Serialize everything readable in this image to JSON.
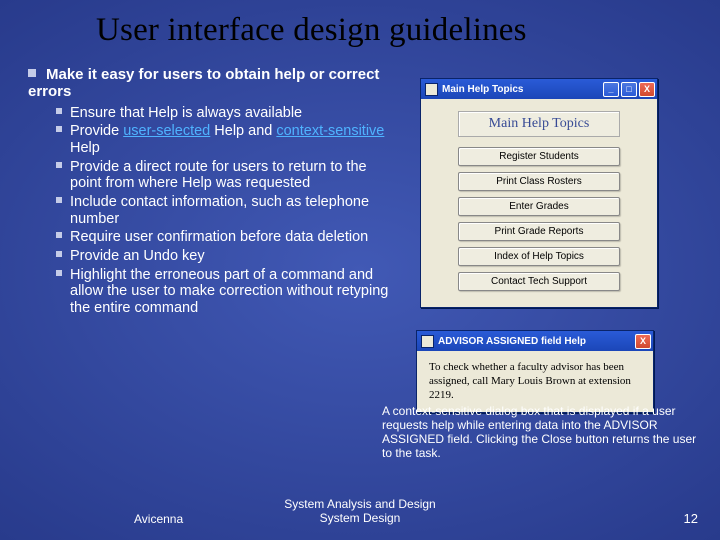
{
  "title": "User interface design guidelines",
  "bullet_heading": "Make it easy for users to obtain help or correct errors",
  "bullets": [
    "Ensure that Help is always available",
    {
      "pre": "Provide ",
      "link1": "user-selected",
      "mid": " Help and ",
      "link2": "context-sensitive",
      "post": " Help"
    },
    "Provide a direct route for users to return to the point from where Help was requested",
    "Include contact information, such as telephone number",
    "Require user confirmation before data deletion",
    "Provide an Undo key",
    "Highlight the erroneous part of a command and allow the user to make correction without retyping the entire command"
  ],
  "dialog1": {
    "title": "Main Help Topics",
    "banner": "Main Help Topics",
    "buttons": [
      "Register Students",
      "Print Class Rosters",
      "Enter Grades",
      "Print Grade Reports",
      "Index of Help Topics",
      "Contact Tech Support"
    ],
    "min": "_",
    "max": "□",
    "close": "X"
  },
  "dialog2": {
    "title": "ADVISOR ASSIGNED field Help",
    "text": "To check whether a faculty advisor has been assigned, call Mary Louis Brown at extension 2219.",
    "close": "X"
  },
  "caption": "A context-sensitive dialog box that is displayed if a user requests help while entering data into the ADVISOR ASSIGNED field. Clicking the Close button returns the user to the task.",
  "author": "Avicenna",
  "center1": "System Analysis and Design",
  "center2": "System Design",
  "page": "12"
}
